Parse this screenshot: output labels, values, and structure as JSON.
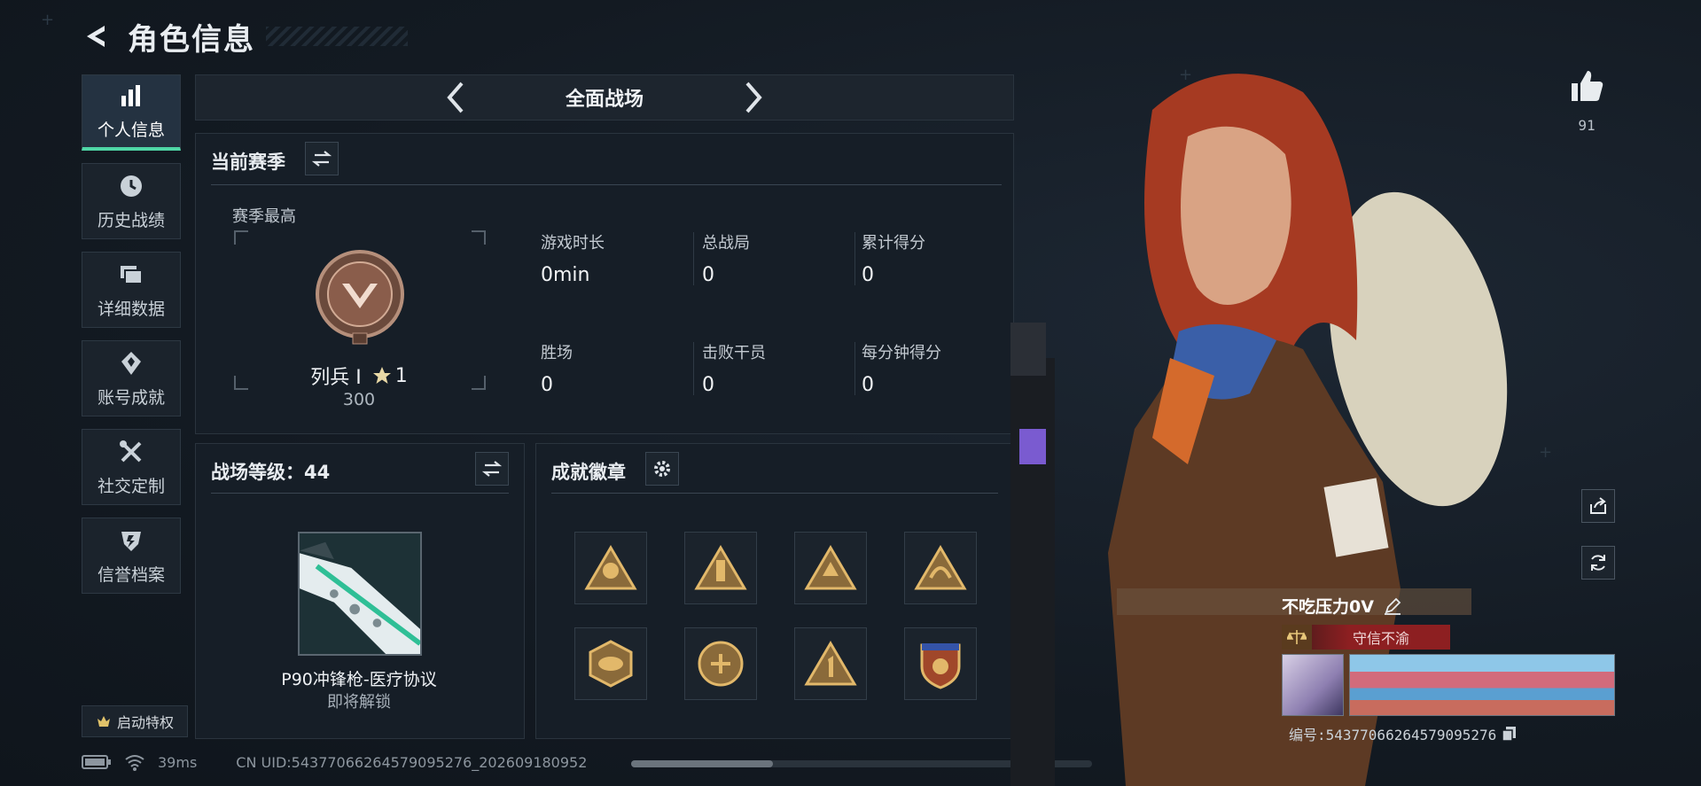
{
  "header": {
    "title": "角色信息"
  },
  "sidebar": {
    "items": [
      {
        "label": "个人信息",
        "icon": "bar-chart-icon",
        "active": true
      },
      {
        "label": "历史战绩",
        "icon": "clock-icon"
      },
      {
        "label": "详细数据",
        "icon": "folder-icon"
      },
      {
        "label": "账号成就",
        "icon": "medal-icon"
      },
      {
        "label": "社交定制",
        "icon": "tools-icon"
      },
      {
        "label": "信誉档案",
        "icon": "shield-icon"
      }
    ],
    "privilege_label": "启动特权"
  },
  "mode": {
    "title": "全面战场"
  },
  "season": {
    "title": "当前赛季",
    "best_label": "赛季最高",
    "rank_name": "列兵 Ⅰ",
    "rank_stars": "1",
    "rank_points": "300",
    "stats": [
      {
        "label": "游戏时长",
        "value": "0min"
      },
      {
        "label": "总战局",
        "value": "0"
      },
      {
        "label": "累计得分",
        "value": "0"
      },
      {
        "label": "胜场",
        "value": "0"
      },
      {
        "label": "击败干员",
        "value": "0"
      },
      {
        "label": "每分钟得分",
        "value": "0"
      }
    ]
  },
  "battlefield": {
    "level_label": "战场等级：44",
    "weapon_name": "P90冲锋枪-医疗协议",
    "weapon_status": "即将解锁"
  },
  "achievements": {
    "title": "成就徽章",
    "badges": [
      "badge-1",
      "badge-2",
      "badge-3",
      "badge-4",
      "badge-5",
      "badge-6",
      "badge-7",
      "badge-8"
    ]
  },
  "footer": {
    "ping": "39ms",
    "uid": "CN UID:5437706626457909527​6_202609180952"
  },
  "profile": {
    "likes": "91",
    "player_name": "不吃压力0V",
    "player_title": "守信不渝",
    "player_id": "编号:5437706626457909527​6"
  },
  "colors": {
    "accent": "#4fd6a6",
    "title_red": "#8d1f21"
  }
}
